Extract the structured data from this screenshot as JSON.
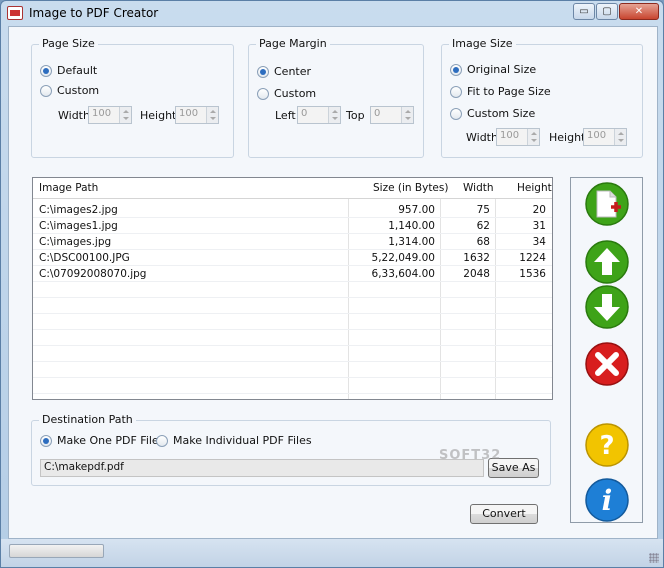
{
  "window": {
    "title": "Image to PDF Creator",
    "minimize": "▭",
    "maximize": "▢",
    "close": "✕"
  },
  "page_size": {
    "legend": "Page Size",
    "options": [
      "Default",
      "Custom"
    ],
    "selected": "Default",
    "width_label": "Width",
    "width_value": "100",
    "height_label": "Height",
    "height_value": "100"
  },
  "page_margin": {
    "legend": "Page Margin",
    "options": [
      "Center",
      "Custom"
    ],
    "selected": "Center",
    "left_label": "Left",
    "left_value": "0",
    "top_label": "Top",
    "top_value": "0"
  },
  "image_size": {
    "legend": "Image Size",
    "options": [
      "Original Size",
      "Fit to Page Size",
      "Custom Size"
    ],
    "selected": "Original Size",
    "width_label": "Width",
    "width_value": "100",
    "height_label": "Height",
    "height_value": "100"
  },
  "grid": {
    "columns": [
      "Image Path",
      "Size (in Bytes)",
      "Width",
      "Height"
    ],
    "rows": [
      {
        "path": "C:\\images2.jpg",
        "size": "957.00",
        "width": "75",
        "height": "20"
      },
      {
        "path": "C:\\images1.jpg",
        "size": "1,140.00",
        "width": "62",
        "height": "31"
      },
      {
        "path": "C:\\images.jpg",
        "size": "1,314.00",
        "width": "68",
        "height": "34"
      },
      {
        "path": "C:\\DSC00100.JPG",
        "size": "5,22,049.00",
        "width": "1632",
        "height": "1224"
      },
      {
        "path": "C:\\07092008070.jpg",
        "size": "6,33,604.00",
        "width": "2048",
        "height": "1536"
      }
    ]
  },
  "destination": {
    "legend": "Destination Path",
    "options": [
      "Make One PDF File",
      "Make Individual PDF Files"
    ],
    "selected": "Make One PDF File",
    "path_value": "C:\\makepdf.pdf",
    "save_as_label": "Save As"
  },
  "convert_label": "Convert",
  "side_buttons": {
    "add": "add-image-icon",
    "up": "move-up-icon",
    "down": "move-down-icon",
    "remove": "remove-icon",
    "help": "help-icon",
    "info": "info-icon"
  },
  "watermark": "SOFT32",
  "colors": {
    "green": "#3ea318",
    "red": "#d81e1e",
    "yellow": "#f2c400",
    "blue": "#1e7fd6"
  }
}
